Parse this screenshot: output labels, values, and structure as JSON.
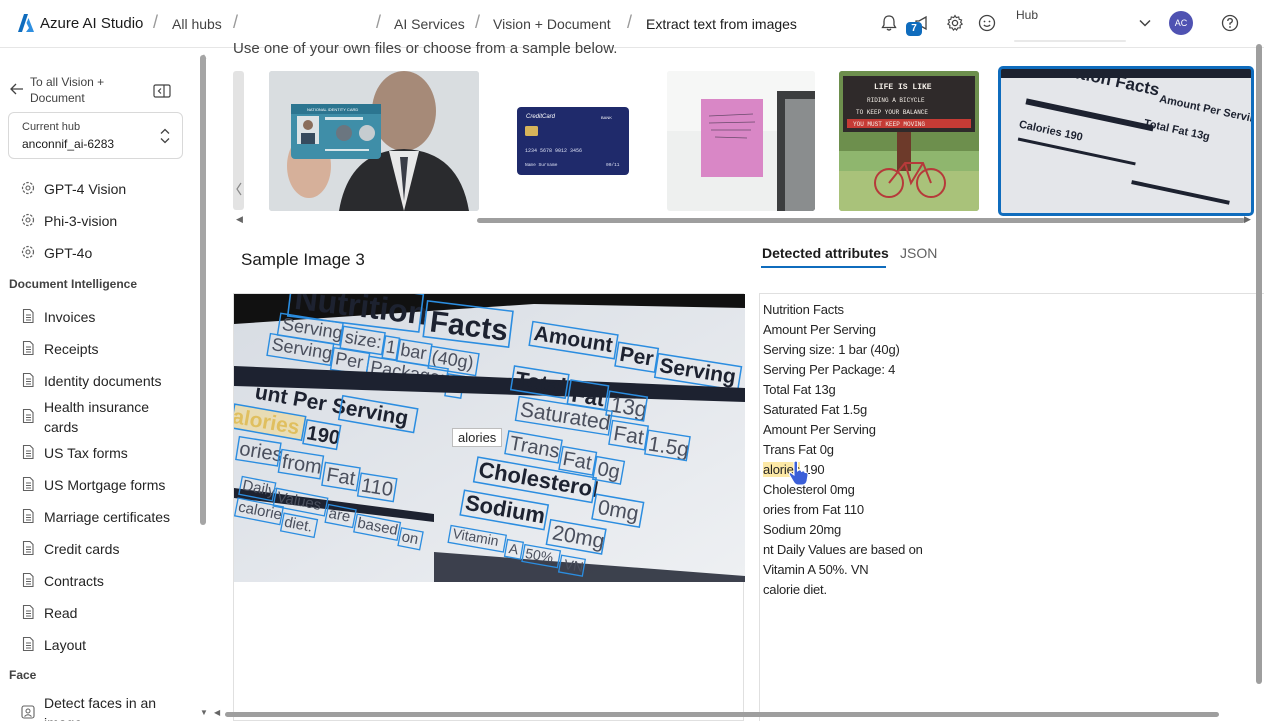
{
  "app": {
    "name": "Azure AI Studio"
  },
  "breadcrumbs": [
    "All hubs",
    "AI Services",
    "Vision + Document",
    "Extract text from images"
  ],
  "topbar": {
    "notification_count": "7",
    "hub_label": "Hub",
    "avatar_initials": "AC"
  },
  "sidebar": {
    "back_link": "To all Vision + Document",
    "current_hub_label": "Current hub",
    "current_hub_value": "anconnif_ai-6283",
    "vision_items": [
      "GPT-4 Vision",
      "Phi-3-vision",
      "GPT-4o"
    ],
    "doc_intel_heading": "Document Intelligence",
    "doc_intel_items": [
      "Invoices",
      "Receipts",
      "Identity documents",
      "Health insurance cards",
      "US Tax forms",
      "US Mortgage forms",
      "Marriage certificates",
      "Credit cards",
      "Contracts",
      "Read",
      "Layout"
    ],
    "face_heading": "Face",
    "face_items": [
      "Detect faces in an image"
    ]
  },
  "main": {
    "intro": "Use one of your own files or choose from a sample below.",
    "sample_title": "Sample Image 3",
    "tabs": [
      "Detected attributes",
      "JSON"
    ],
    "tooltip": "alories",
    "thumb_texts": {
      "credit_card": "CreditCard",
      "bank": "BANK",
      "card_number": "1234 5678 9012 3456",
      "card_name": "Name Surname",
      "card_exp": "00/11",
      "id_card": "NATIONAL IDENTITY CARD",
      "sign1": "LIFE IS LIKE",
      "sign2": "RIDING A BICYCLE",
      "sign3": "TO KEEP YOUR BALANCE",
      "sign4": "YOU MUST KEEP MOVING",
      "nf1": "Nutrition Facts",
      "nf2": "Amount Per Serving",
      "nf3": "Total Fat 13g",
      "nf4": "Calories 190"
    },
    "detected_lines": [
      "Nutrition Facts",
      "Amount Per Serving",
      "Serving size: 1 bar (40g)",
      "Serving Per Package: 4",
      "Total Fat 13g",
      "Saturated Fat 1.5g",
      "Amount Per Serving",
      "Trans Fat 0g",
      "alories 190",
      "Cholesterol 0mg",
      "ories from Fat 110",
      "Sodium 20mg",
      "nt Daily Values are based on",
      "Vitamin A 50%. VN",
      "calorie diet."
    ],
    "detected_highlight": "alories",
    "detected_highlight_rest": " 190",
    "image_words": {
      "nutrition": "Nutrition",
      "facts": "Facts",
      "serving": "Serving",
      "size": "size:",
      "one": "1",
      "bar": "bar",
      "forty": "(40g)",
      "per": "Per",
      "package": "Package:",
      "four": "4",
      "amount": "Amount",
      "per2": "Per",
      "serving2": "Serving",
      "amount_left": "unt Per Serving",
      "calories": "alories",
      "c190": "190",
      "total": "Total",
      "fat": "Fat",
      "f13": "13g",
      "saturated": "Saturated",
      "fat2": "Fat",
      "f15": "1.5g",
      "ories": "ories",
      "from": "from",
      "fat3": "Fat",
      "f110": "110",
      "trans": "Trans",
      "fat4": "Fat",
      "f0g": "0g",
      "cholesterol": "Cholesterol",
      "c0mg": "0mg",
      "daily": "Daily",
      "values": "Values",
      "are": "are",
      "based": "based",
      "on": "on",
      "calorie": "calorie",
      "diet": "diet.",
      "sodium": "Sodium",
      "s20": "20mg",
      "vitamin": "Vitamin",
      "v1": "A",
      "v2": "50%",
      "v3": "VN"
    }
  }
}
